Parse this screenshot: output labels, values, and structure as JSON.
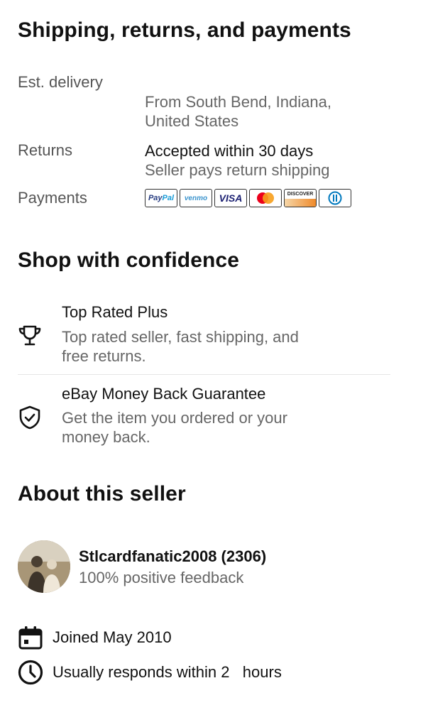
{
  "shipping": {
    "title": "Shipping, returns, and payments",
    "est_delivery_label": "Est. delivery",
    "est_delivery_origin": "From South Bend, Indiana, United States",
    "est_delivery_origin_line1": "From South Bend, Indiana,",
    "est_delivery_origin_line2": "United States",
    "returns_label": "Returns",
    "returns_value": "Accepted within 30 days",
    "returns_sub": "Seller pays return shipping",
    "payments_label": "Payments",
    "payment_methods": [
      {
        "name": "PayPal",
        "icon": "paypal-logo-icon",
        "text_a": "Pay",
        "text_b": "Pal"
      },
      {
        "name": "venmo",
        "icon": "venmo-logo-icon"
      },
      {
        "name": "VISA",
        "icon": "visa-logo-icon"
      },
      {
        "name": "Mastercard",
        "icon": "mastercard-logo-icon"
      },
      {
        "name": "DISCOVER",
        "icon": "discover-logo-icon"
      },
      {
        "name": "Diners Club",
        "icon": "diners-club-logo-icon"
      }
    ]
  },
  "confidence": {
    "title": "Shop with confidence",
    "items": [
      {
        "icon": "trophy-icon",
        "title": "Top Rated Plus",
        "desc_line1": "Top rated seller, fast shipping, and",
        "desc_line2": "free returns."
      },
      {
        "icon": "shield-check-icon",
        "title": "eBay Money Back Guarantee",
        "desc_line1": "Get the item you ordered or your",
        "desc_line2": "money back."
      }
    ]
  },
  "seller": {
    "title": "About this seller",
    "name_with_score": "Stlcardfanatic2008 (2306)",
    "feedback": "100% positive feedback",
    "joined": "Joined May 2010",
    "responds": "Usually responds within 2   hours"
  },
  "colors": {
    "text_primary": "#111111",
    "text_secondary": "#555555",
    "mastercard_red": "#eb001b",
    "mastercard_orange": "#f79e1b",
    "visa_blue": "#1a1f71",
    "venmo_blue": "#3d95ce",
    "paypal_dark": "#253b80",
    "paypal_light": "#179bd7"
  }
}
